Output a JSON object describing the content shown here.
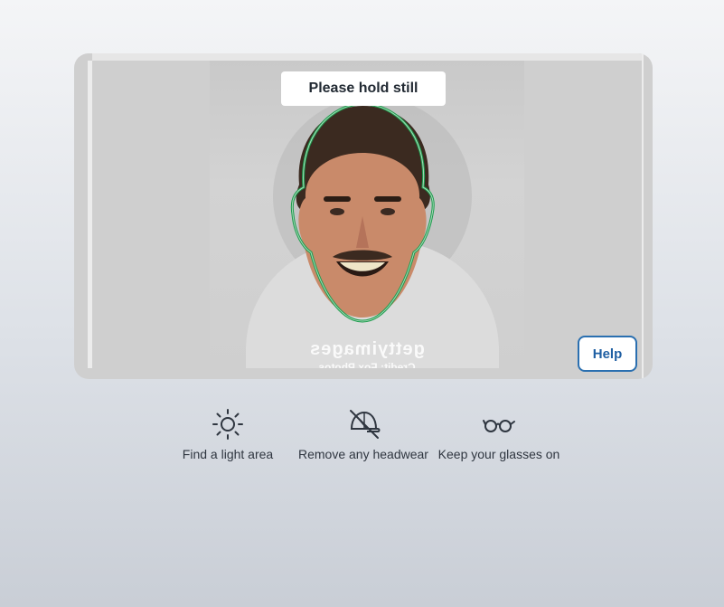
{
  "camera": {
    "status_text": "Please hold still",
    "watermark_brand": "gettyimages",
    "watermark_sub": "Credit: Fox Photos"
  },
  "help_button": {
    "label": "Help"
  },
  "tips": [
    {
      "icon": "sun-icon",
      "label": "Find a light area"
    },
    {
      "icon": "no-hat-icon",
      "label": "Remove any headwear"
    },
    {
      "icon": "glasses-icon",
      "label": "Keep your glasses on"
    }
  ],
  "colors": {
    "face_outline": "#1e9c4d",
    "accent": "#2a6fb0",
    "text": "#2f3640"
  }
}
